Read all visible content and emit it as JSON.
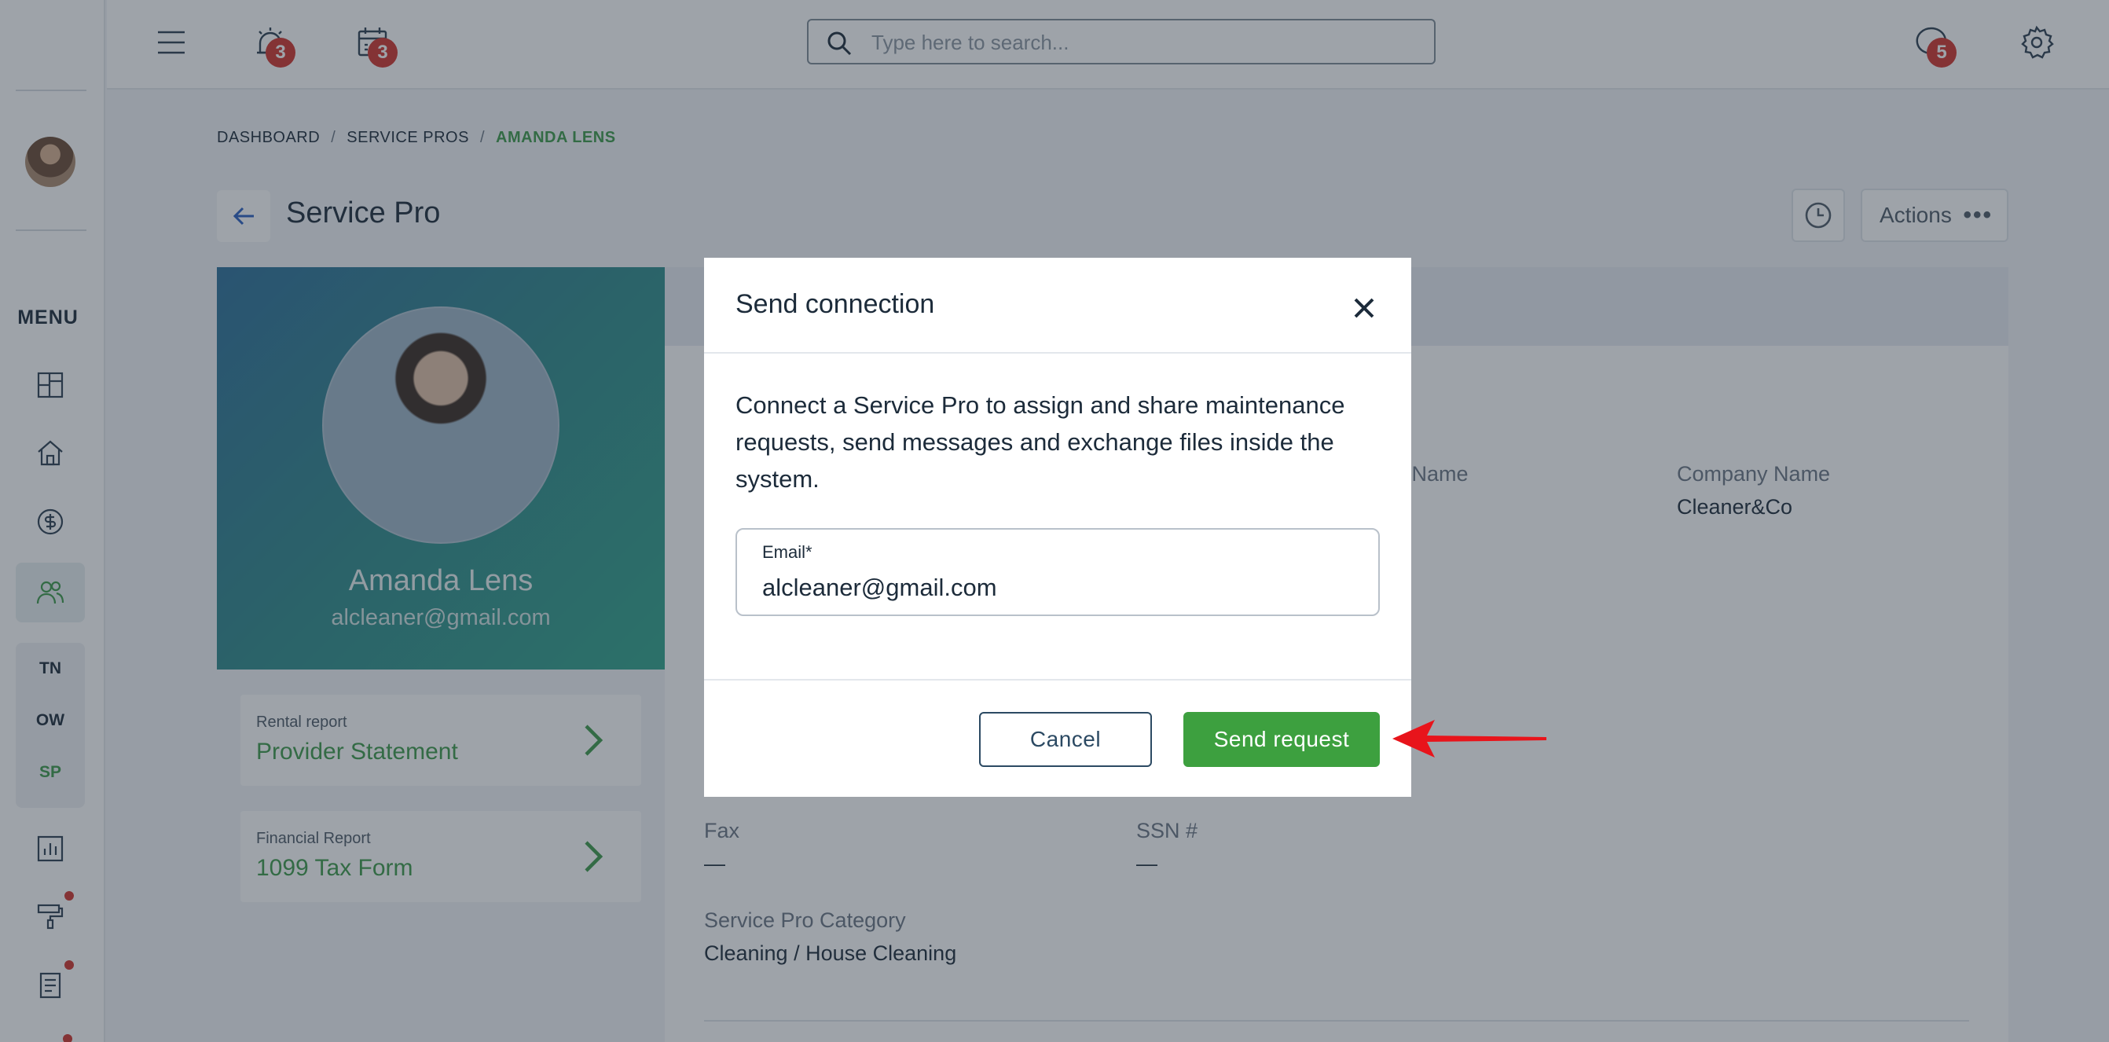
{
  "topbar": {
    "alerts_badge": "3",
    "calendar_badge": "3",
    "messages_badge": "5",
    "search_placeholder": "Type here to search..."
  },
  "sidebar": {
    "menu_label": "MENU",
    "groups": [
      "TN",
      "OW",
      "SP"
    ],
    "active_group": "SP"
  },
  "breadcrumb": {
    "items": [
      "DASHBOARD",
      "SERVICE PROS",
      "AMANDA LENS"
    ]
  },
  "page": {
    "title": "Service Pro",
    "actions_label": "Actions"
  },
  "profile": {
    "name": "Amanda Lens",
    "email": "alcleaner@gmail.com"
  },
  "reports": [
    {
      "kind": "Rental report",
      "title": "Provider Statement"
    },
    {
      "kind": "Financial Report",
      "title": "1099 Tax Form"
    }
  ],
  "details": {
    "partial_label": "e Name",
    "company_name_label": "Company Name",
    "company_name_value": "Cleaner&Co",
    "fax_label": "Fax",
    "fax_value": "—",
    "ssn_label": "SSN #",
    "ssn_value": "—",
    "category_label": "Service Pro Category",
    "category_value": "Cleaning / House Cleaning"
  },
  "modal": {
    "title": "Send connection",
    "description": "Connect a Service Pro to assign and share maintenance requests, send messages and exchange files inside the system.",
    "email_label": "Email*",
    "email_value": "alcleaner@gmail.com",
    "cancel_label": "Cancel",
    "send_label": "Send request"
  },
  "colors": {
    "accent_green": "#3da03f",
    "badge_red": "#d0342c",
    "annotation_arrow": "#e8141b"
  }
}
